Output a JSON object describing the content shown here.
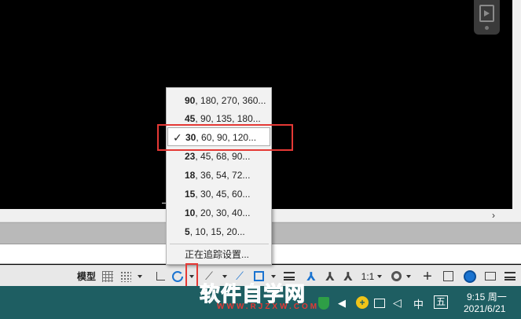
{
  "menu": {
    "items": [
      {
        "lead": "90",
        "rest": ", 180, 270, 360...",
        "checked": false
      },
      {
        "lead": "45",
        "rest": ", 90, 135, 180...",
        "checked": false
      },
      {
        "lead": "30",
        "rest": ", 60, 90, 120...",
        "checked": true
      },
      {
        "lead": "23",
        "rest": ", 45, 68, 90...",
        "checked": false
      },
      {
        "lead": "18",
        "rest": ", 36, 54, 72...",
        "checked": false
      },
      {
        "lead": "15",
        "rest": ", 30, 45, 60...",
        "checked": false
      },
      {
        "lead": "10",
        "rest": ", 20, 30, 40...",
        "checked": false
      },
      {
        "lead": "5",
        "rest": ", 10, 15, 20...",
        "checked": false
      }
    ],
    "check_mark": "✓",
    "settings_label": "正在追踪设置..."
  },
  "statusbar": {
    "model_label": "模型",
    "scale_label": "1:1"
  },
  "taskbar": {
    "ime_mode": "中",
    "ime_shape": "五",
    "plus_icon": "+",
    "time": "9:15 周一",
    "date": "2021/6/21"
  },
  "watermark": {
    "title": "软件自学网",
    "url": "WWW.RJZXW.COM"
  },
  "colors": {
    "highlight": "#e53935",
    "accent": "#1a73d0",
    "taskbar": "#1e5e62"
  }
}
